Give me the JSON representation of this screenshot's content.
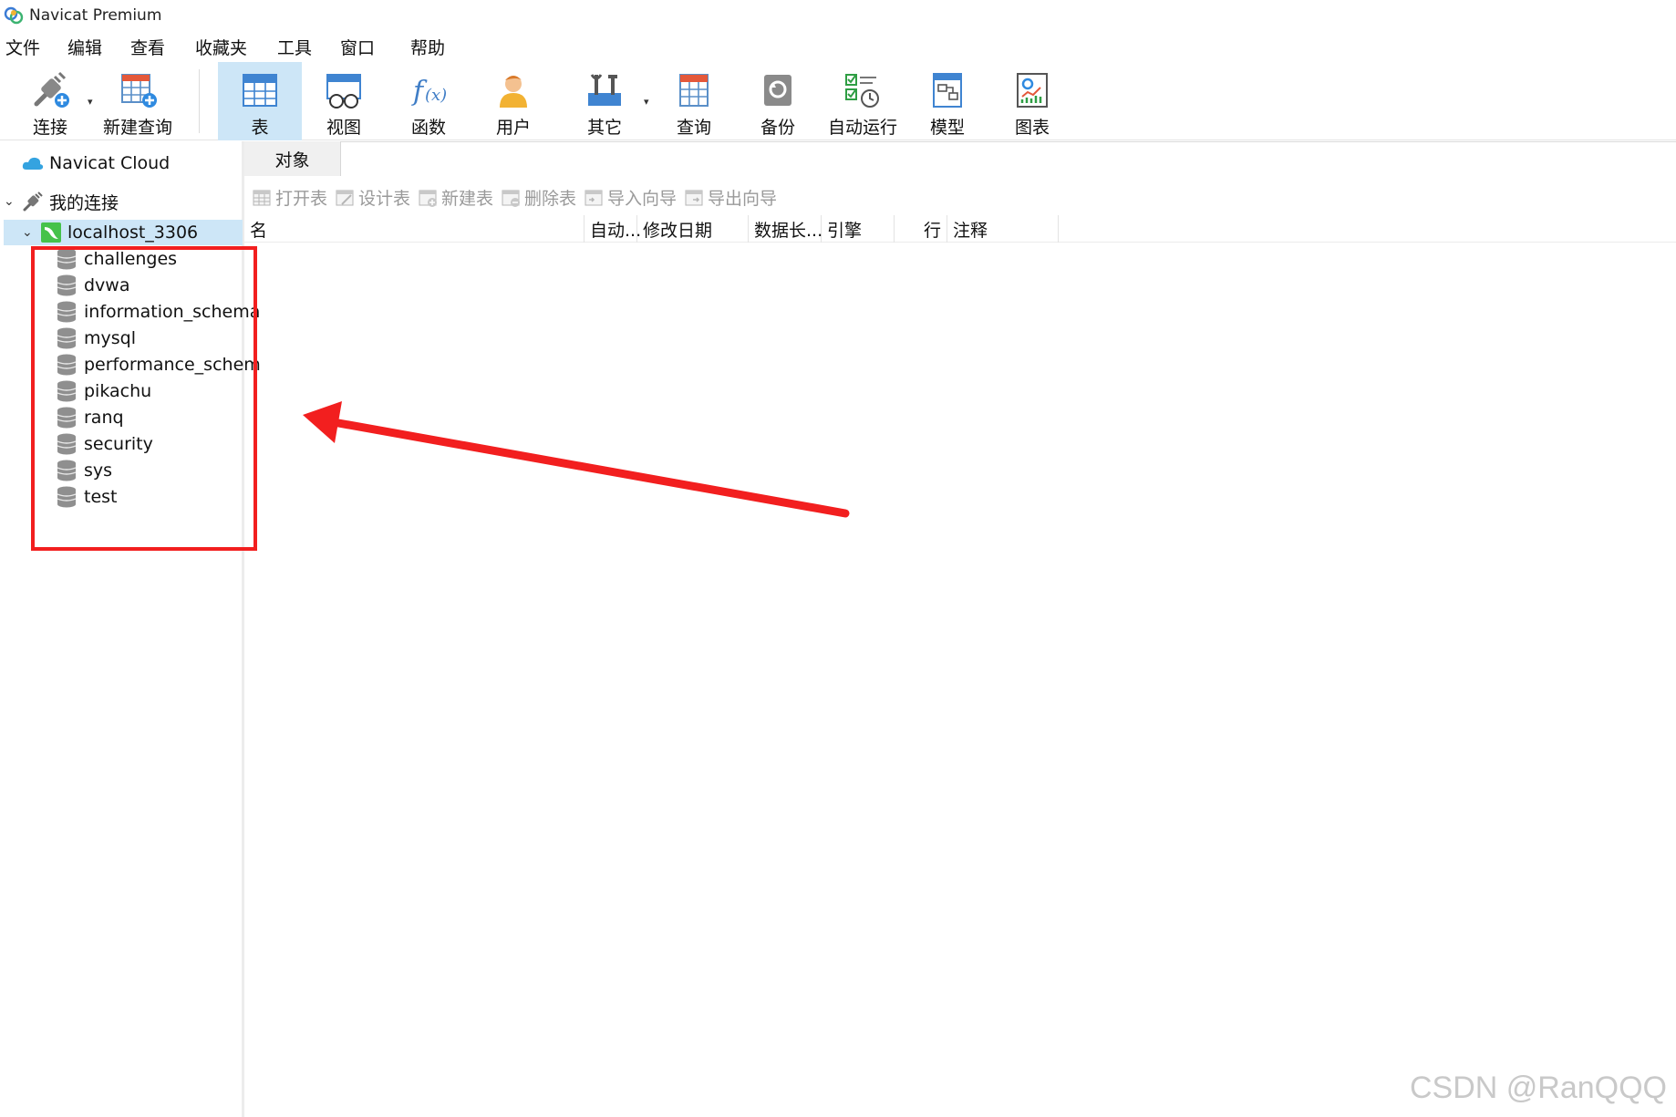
{
  "window": {
    "title": "Navicat Premium"
  },
  "menu": [
    "文件",
    "编辑",
    "查看",
    "收藏夹",
    "工具",
    "窗口",
    "帮助"
  ],
  "toolbar": {
    "connect": "连接",
    "new_query": "新建查询",
    "table": "表",
    "view": "视图",
    "function": "函数",
    "user": "用户",
    "other": "其它",
    "query": "查询",
    "backup": "备份",
    "auto_run": "自动运行",
    "model": "模型",
    "chart": "图表",
    "active_tool": "表"
  },
  "sidebar": {
    "cloud": "Navicat Cloud",
    "my_connections": "我的连接",
    "connection": "localhost_3306",
    "databases": [
      "challenges",
      "dvwa",
      "information_schema",
      "mysql",
      "performance_schem",
      "pikachu",
      "ranq",
      "security",
      "sys",
      "test"
    ]
  },
  "tabs": {
    "objects": "对象"
  },
  "object_toolbar": {
    "open_table": "打开表",
    "design_table": "设计表",
    "new_table": "新建表",
    "delete_table": "删除表",
    "import_wizard": "导入向导",
    "export_wizard": "导出向导"
  },
  "columns": {
    "name": "名",
    "auto_inc": "自动...",
    "modified": "修改日期",
    "data_length": "数据长...",
    "engine": "引擎",
    "rows": "行",
    "comment": "注释"
  },
  "watermark": "CSDN @RanQQQ",
  "colors": {
    "annotation": "#f21f1f",
    "selection": "#cde6f7"
  }
}
